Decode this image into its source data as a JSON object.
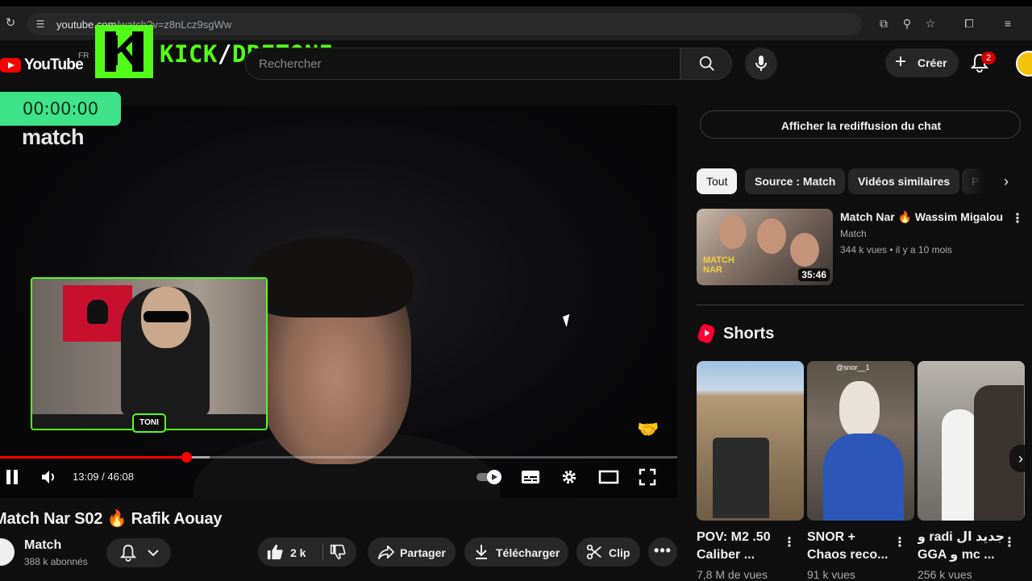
{
  "browser": {
    "url_host": "youtube.com",
    "url_path": "/watch?v=z8nLcz9sgWw"
  },
  "masthead": {
    "logo_text": "YouTube",
    "country_code": "FR",
    "overlay_logo_text": "KICK",
    "overlay_logo_slash": "/",
    "overlay_logo_handle": "DRETONI",
    "search_placeholder": "Rechercher",
    "create_label": "Créer",
    "notification_count": "2"
  },
  "player": {
    "stream_timer": "00:00:00",
    "brand_watermark": "match",
    "webcam_tag": "TONI",
    "current_time": "13:09",
    "duration": "46:08",
    "time_separator": " / ",
    "progress_fraction": 0.2748,
    "buffer_fraction": 0.31
  },
  "video": {
    "title": "Match Nar S02 🔥 Rafik Aouay",
    "channel_name": "Match",
    "channel_subscribers": "388 k abonnés",
    "like_count": "2 k",
    "share_label": "Partager",
    "download_label": "Télécharger",
    "clip_label": "Clip"
  },
  "sidebar": {
    "chat_replay_label": "Afficher la rediffusion du chat",
    "chips": [
      "Tout",
      "Source : Match",
      "Vidéos similaires",
      "P"
    ],
    "recommendation": {
      "title": "Match Nar 🔥 Wassim Migalou",
      "channel": "Match",
      "meta": "344 k vues • il y a 10 mois",
      "duration": "35:46",
      "thumb_text": "MATCH NAR"
    },
    "shorts_heading": "Shorts",
    "shorts": [
      {
        "title_line1": "POV: M2 .50",
        "title_line2": "Caliber ...",
        "views": "7,8 M de vues"
      },
      {
        "title_line1": "SNOR +",
        "title_line2": "Chaos reco...",
        "views": "91 k vues",
        "overlay_text": "@snor__1"
      },
      {
        "title_line1": "و radi جديد ال",
        "title_line2": "GGA و mc ...",
        "views": "256 k vues"
      }
    ]
  }
}
